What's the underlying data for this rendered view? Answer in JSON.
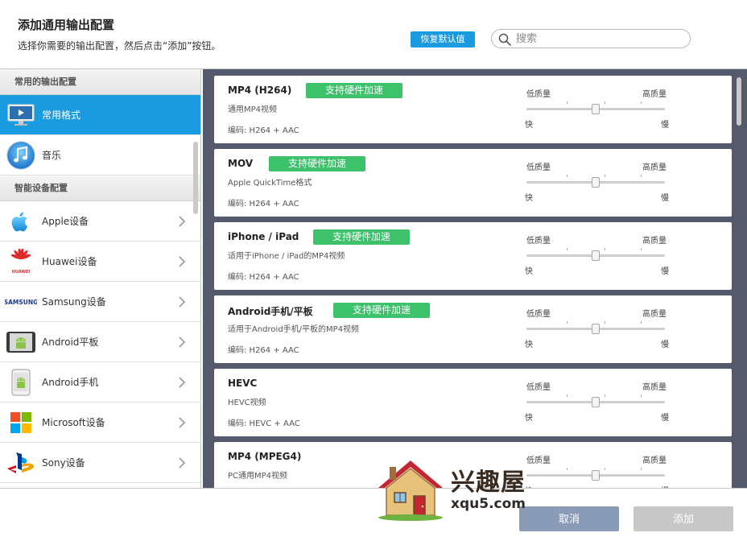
{
  "header": {
    "title": "添加通用输出配置",
    "subtitle": "选择你需要的输出配置，然后点击“添加”按钮。",
    "restore_label": "恢复默认值",
    "search_placeholder": "搜索"
  },
  "sidebar": {
    "sections": [
      {
        "title": "常用的输出配置",
        "items": [
          {
            "label": "常用格式",
            "icon": "monitor-icon",
            "active": true
          },
          {
            "label": "音乐",
            "icon": "music-note-icon",
            "active": false
          }
        ]
      },
      {
        "title": "智能设备配置",
        "items": [
          {
            "label": "Apple设备",
            "icon": "apple-logo-icon"
          },
          {
            "label": "Huawei设备",
            "icon": "huawei-logo-icon"
          },
          {
            "label": "Samsung设备",
            "icon": "samsung-logo-icon"
          },
          {
            "label": "Android平板",
            "icon": "android-tablet-icon"
          },
          {
            "label": "Android手机",
            "icon": "android-phone-icon"
          },
          {
            "label": "Microsoft设备",
            "icon": "microsoft-logo-icon"
          },
          {
            "label": "Sony设备",
            "icon": "playstation-logo-icon"
          }
        ]
      }
    ],
    "samsung_wordmark": "SAMSUNG",
    "huawei_wordmark": "HUAWEI"
  },
  "profiles": [
    {
      "name": "MP4 (H264)",
      "badge": "支持硬件加速",
      "desc": "通用MP4视频",
      "codec": "编码:   H264 + AAC"
    },
    {
      "name": "MOV",
      "badge": "支持硬件加速",
      "desc": "Apple QuickTime格式",
      "codec": "编码:   H264 + AAC"
    },
    {
      "name": "iPhone / iPad",
      "badge": "支持硬件加速",
      "desc": "适用于iPhone / iPad的MP4视频",
      "codec": "编码:   H264 + AAC"
    },
    {
      "name": "Android手机/平板",
      "badge": "支持硬件加速",
      "desc": "适用于Android手机/平板的MP4视频",
      "codec": "编码:   H264 + AAC"
    },
    {
      "name": "HEVC",
      "badge": "",
      "desc": "HEVC视频",
      "codec": "编码:   HEVC + AAC"
    },
    {
      "name": "MP4 (MPEG4)",
      "badge": "",
      "desc": "PC通用MP4视频",
      "codec": ""
    }
  ],
  "quality_slider": {
    "low_label": "低质量",
    "high_label": "高质量",
    "fast_label": "快",
    "slow_label": "慢",
    "value_fraction": 0.5
  },
  "footer": {
    "cancel_label": "取消",
    "add_label": "添加"
  },
  "watermark": {
    "cn": "兴趣屋",
    "url": "xqu5.com"
  },
  "colors": {
    "accent": "#1a9be0",
    "badge_green": "#3ec16b",
    "content_bg": "#54596b",
    "cancel_bg": "#8a9bb8",
    "add_disabled_bg": "#c7c7c7"
  }
}
